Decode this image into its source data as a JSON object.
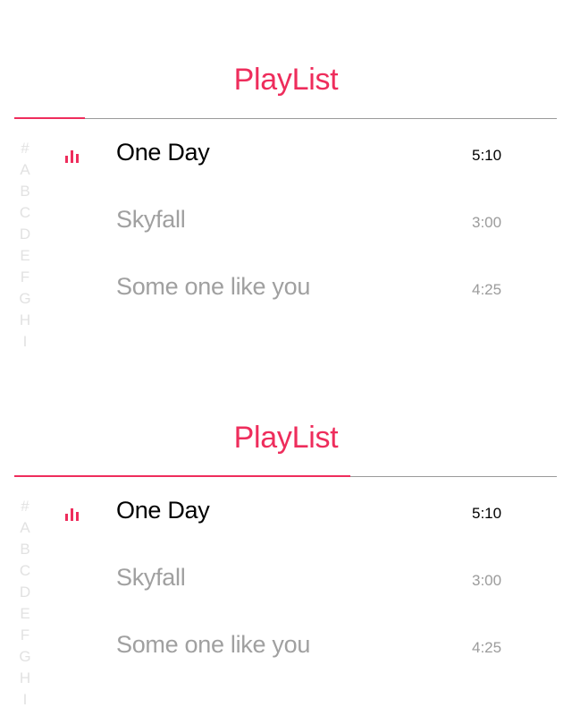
{
  "panels": [
    {
      "title": "PlayList",
      "progress": 0.13,
      "index_letters": [
        "#",
        "A",
        "B",
        "C",
        "D",
        "E",
        "F",
        "G",
        "H",
        "I"
      ],
      "tracks": [
        {
          "name": "One Day",
          "duration": "5:10",
          "playing": true
        },
        {
          "name": "Skyfall",
          "duration": "3:00",
          "playing": false
        },
        {
          "name": "Some one like you",
          "duration": "4:25",
          "playing": false
        }
      ]
    },
    {
      "title": "PlayList",
      "progress": 0.62,
      "index_letters": [
        "#",
        "A",
        "B",
        "C",
        "D",
        "E",
        "F",
        "G",
        "H",
        "I"
      ],
      "tracks": [
        {
          "name": "One Day",
          "duration": "5:10",
          "playing": true
        },
        {
          "name": "Skyfall",
          "duration": "3:00",
          "playing": false
        },
        {
          "name": "Some one like you",
          "duration": "4:25",
          "playing": false
        }
      ]
    }
  ],
  "colors": {
    "accent": "#ee2d5c",
    "divider": "#9a9a9a",
    "inactive_text": "#a0a0a0",
    "active_text": "#000000",
    "index_text": "#e2e2e2"
  },
  "icons": {
    "now_playing": "equalizer-icon"
  }
}
